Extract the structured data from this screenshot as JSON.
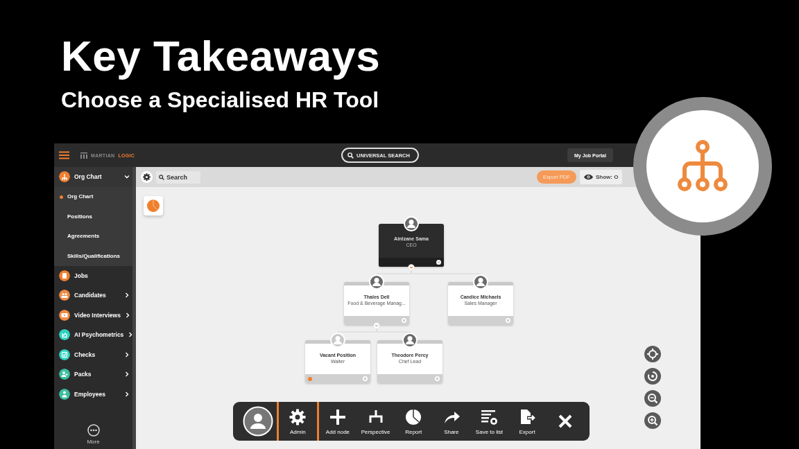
{
  "slide": {
    "title": "Key Takeaways",
    "subtitle": "Choose a Specialised HR Tool"
  },
  "top_bar": {
    "logo": [
      "MARTIAN",
      "LOGIC"
    ],
    "search": "UNIVERSAL SEARCH",
    "portal_button": "My Job Portal"
  },
  "sidebar": {
    "items": [
      {
        "label": "Org Chart",
        "color": "#f07f2e",
        "expanded": true,
        "children": [
          {
            "label": "Org Chart",
            "selected": true
          },
          {
            "label": "Positions",
            "selected": false
          },
          {
            "label": "Agreements",
            "selected": false
          },
          {
            "label": "Skills/Qualifications",
            "selected": false
          }
        ]
      },
      {
        "label": "Jobs",
        "color": "#f07f2e"
      },
      {
        "label": "Candidates",
        "color": "#f08a45",
        "expanded": false
      },
      {
        "label": "Video Interviews",
        "color": "#f08a45",
        "expanded": false
      },
      {
        "label": "AI Psychometrics",
        "color": "#2ed3c0",
        "expanded": false
      },
      {
        "label": "Checks",
        "color": "#2ed3c0",
        "expanded": false
      },
      {
        "label": "Packs",
        "color": "#3cbf9e",
        "expanded": false
      },
      {
        "label": "Employees",
        "color": "#3cbf9e",
        "expanded": false
      }
    ],
    "more": "More"
  },
  "toolbar": {
    "search": {
      "placeholder": "Search"
    },
    "export_button": "Export PDF",
    "show_label": "Show: O"
  },
  "org_chart": {
    "root": {
      "name": "Aintzane Sama",
      "role": "CEO",
      "selected": true,
      "vacant": false,
      "children": [
        {
          "name": "Thales Dell",
          "role": "Food & Beverage Manag...",
          "selected": false,
          "vacant": false,
          "children": [
            {
              "name": "Vacant Position",
              "role": "Waiter",
              "selected": false,
              "vacant": true
            },
            {
              "name": "Theodore Percy",
              "role": "Chef Lead",
              "selected": false,
              "vacant": false
            }
          ]
        },
        {
          "name": "Candice Michaels",
          "role": "Sales Manager",
          "selected": false,
          "vacant": false
        }
      ]
    }
  },
  "action_bar": [
    {
      "kind": "avatar"
    },
    {
      "kind": "gear",
      "label": "Admin"
    },
    {
      "kind": "add",
      "label": "Add node"
    },
    {
      "kind": "perspective",
      "label": "Perspective"
    },
    {
      "kind": "report",
      "label": "Report"
    },
    {
      "kind": "share",
      "label": "Share"
    },
    {
      "kind": "save",
      "label": "Save to list"
    },
    {
      "kind": "export",
      "label": "Export"
    },
    {
      "kind": "close"
    }
  ]
}
